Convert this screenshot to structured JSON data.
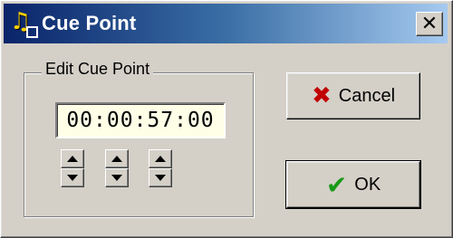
{
  "window": {
    "title": "Cue Point",
    "close_glyph": "✕",
    "colors": {
      "titlebar_start": "#0a246a",
      "titlebar_end": "#a6caf0",
      "face": "#d4d0c8",
      "field_bg": "#ffffe8"
    }
  },
  "app_icon": {
    "name": "music-note-icon",
    "glyph": "♫"
  },
  "group": {
    "label": "Edit Cue Point",
    "time_value": "00:00:57:00",
    "spinners": [
      {
        "name": "hours-spinner"
      },
      {
        "name": "minutes-spinner"
      },
      {
        "name": "seconds-spinner"
      }
    ]
  },
  "buttons": {
    "cancel": {
      "label": "Cancel",
      "icon": "x-icon",
      "icon_glyph": "✖",
      "icon_color": "#c00000"
    },
    "ok": {
      "label": "OK",
      "icon": "checkmark-icon",
      "icon_glyph": "✔",
      "icon_color": "#1a9a1a"
    }
  }
}
